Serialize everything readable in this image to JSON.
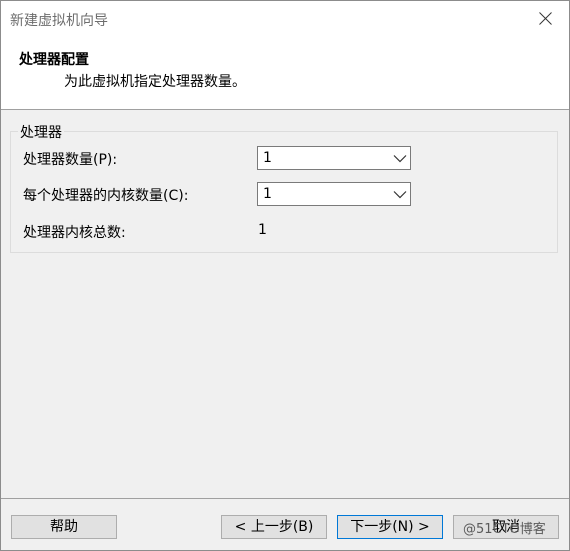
{
  "window": {
    "title": "新建虚拟机向导"
  },
  "header": {
    "title": "处理器配置",
    "subtitle": "为此虚拟机指定处理器数量。"
  },
  "processor_group": {
    "legend": "处理器",
    "processor_count_label": "处理器数量(P):",
    "processor_count_value": "1",
    "cores_per_processor_label": "每个处理器的内核数量(C):",
    "cores_per_processor_value": "1",
    "total_cores_label": "处理器内核总数:",
    "total_cores_value": "1"
  },
  "footer": {
    "help_label": "帮助",
    "back_label": "< 上一步(B)",
    "next_label": "下一步(N) >",
    "cancel_label": "取消"
  },
  "watermark": "@51CTO博客",
  "colors": {
    "accent": "#0078d7",
    "dialog_bg": "#f0f0f0",
    "button_bg": "#e1e1e1"
  }
}
